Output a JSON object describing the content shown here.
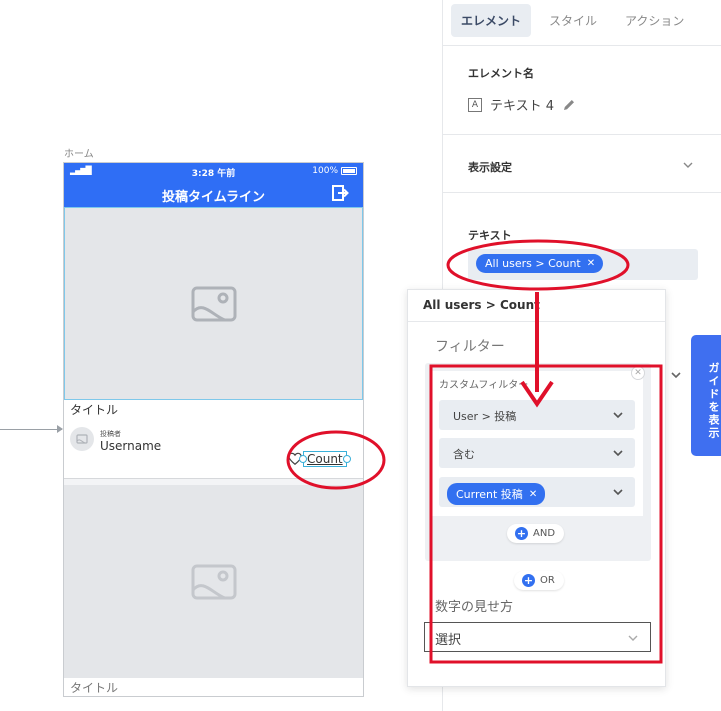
{
  "canvas": {
    "screen_label": "ホーム",
    "status_bar": {
      "signal": "▂▄▆█",
      "time": "3:28 午前",
      "battery": "100%"
    },
    "nav_title": "投稿タイムライン",
    "cards": [
      {
        "title": "タイトル",
        "poster_label": "投稿者",
        "poster_name": "Username",
        "count": "Count"
      },
      {
        "title": "タイトル"
      }
    ]
  },
  "panel": {
    "tabs": [
      "エレメント",
      "スタイル",
      "アクション"
    ],
    "element_name_label": "エレメント名",
    "element_name": "テキスト 4",
    "display_settings": "表示設定",
    "text_label": "テキスト",
    "text_chip": "All users > Count"
  },
  "guide_button": "ガイドを表示",
  "popup": {
    "title": "All users > Count",
    "filter_label": "フィルター",
    "custom_filter_label": "カスタムフィルター",
    "field_dropdown": "User > 投稿",
    "operator_dropdown": "含む",
    "value_chip": "Current 投稿",
    "and_button": "AND",
    "or_button": "OR",
    "number_format_label": "数字の見せ方",
    "number_format_select": "選択"
  },
  "colors": {
    "accent": "#2f6ef5",
    "chip": "#3270f0",
    "annotation": "#e0102a"
  }
}
